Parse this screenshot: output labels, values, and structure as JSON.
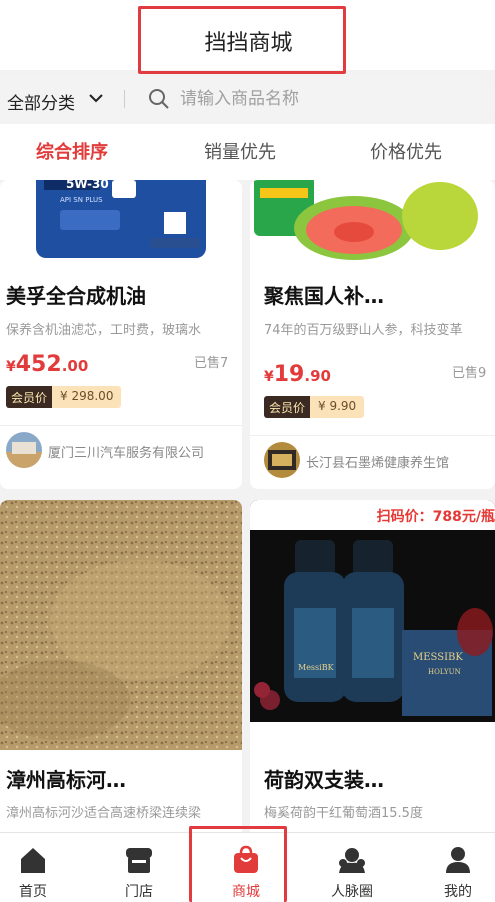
{
  "header": {
    "title": "挡挡商城"
  },
  "search": {
    "category_label": "全部分类",
    "placeholder": "请输入商品名称"
  },
  "sort_tabs": [
    {
      "label": "综合排序",
      "active": true
    },
    {
      "label": "销量优先",
      "active": false
    },
    {
      "label": "价格优先",
      "active": false
    }
  ],
  "products": [
    {
      "image_text": "5W-30",
      "image_text2": "API SN PLUS",
      "name": "美孚全合成机油",
      "desc": "保养含机油滤芯，工时费，玻璃水",
      "price_currency": "¥",
      "price_int": "452",
      "price_dec": ".00",
      "sold": "已售7",
      "member_label": "会员价",
      "member_price": "¥ 298.00",
      "store": "厦门三川汽车服务有限公司"
    },
    {
      "image_text": "",
      "name": "聚焦国人补…",
      "desc": "74年的百万级野山人参，科技变革",
      "price_currency": "¥",
      "price_int": "19",
      "price_dec": ".90",
      "sold": "已售9",
      "member_label": "会员价",
      "member_price": "¥ 9.90",
      "store": "长汀县石墨烯健康养生馆"
    },
    {
      "name": "漳州高标河…",
      "desc": "漳州高标河沙适合高速桥梁连续梁"
    },
    {
      "promo": "扫码价：788元/瓶",
      "bottle_label": "MessiBK",
      "box_label": "MESSIBK",
      "box_sub": "HOLYUN",
      "name": "荷韵双支装…",
      "desc": "梅奚荷韵干红葡萄酒15.5度"
    }
  ],
  "tabbar": [
    {
      "label": "首页",
      "icon": "home-icon",
      "active": false
    },
    {
      "label": "门店",
      "icon": "store-icon",
      "active": false
    },
    {
      "label": "商城",
      "icon": "shopping-bag-icon",
      "active": true
    },
    {
      "label": "人脉圈",
      "icon": "people-icon",
      "active": false
    },
    {
      "label": "我的",
      "icon": "user-icon",
      "active": false
    }
  ],
  "colors": {
    "accent": "#e23b3b",
    "highlight_box": "#e13a3f",
    "member_dark": "#3b2a21",
    "member_light": "#fbe2b8"
  }
}
